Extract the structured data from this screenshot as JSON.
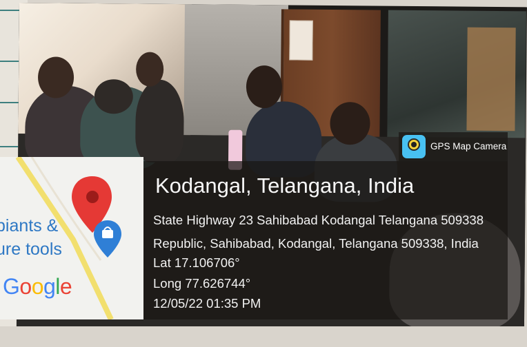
{
  "badge": {
    "app_name": "GPS Map Camera",
    "icon": "gps-map-camera-app-icon"
  },
  "location": {
    "place": "Kodangal, Telangana, India",
    "address_line_1": "State Highway 23 Sahibabad Kodangal Telangana 509338",
    "address_line_2": "Republic, Sahibabad, Kodangal, Telangana 509338, India",
    "lat": "Lat 17.106706°",
    "long": "Long 77.626744°",
    "datetime": "12/05/22 01:35 PM"
  },
  "map": {
    "label_line_1": "piants &",
    "label_line_2": "ure tools",
    "brand": "Google",
    "pin_color": "#e53935",
    "secondary_pin_color": "#2f7fd6"
  }
}
